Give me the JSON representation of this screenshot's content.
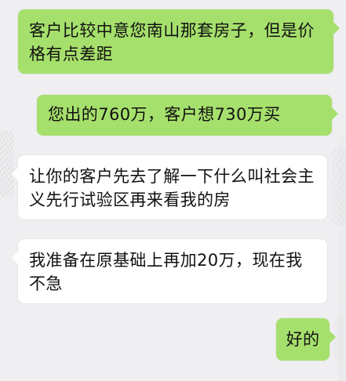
{
  "messages": [
    {
      "side": "outgoing",
      "text": "客户比较中意您南山那套房子，但是价格有点差距"
    },
    {
      "side": "outgoing",
      "text": "您出的760万，客户想730万买"
    },
    {
      "side": "incoming",
      "text": "让你的客户先去了解一下什么叫社会主义先行试验区再来看我的房"
    },
    {
      "side": "incoming",
      "text": "我准备在原基础上再加20万，现在我不急"
    },
    {
      "side": "outgoing",
      "text": "好的"
    }
  ],
  "colors": {
    "background": "#efeff1",
    "outgoing_bubble": "#a6e06c",
    "incoming_bubble": "#ffffff",
    "text": "#111111"
  }
}
